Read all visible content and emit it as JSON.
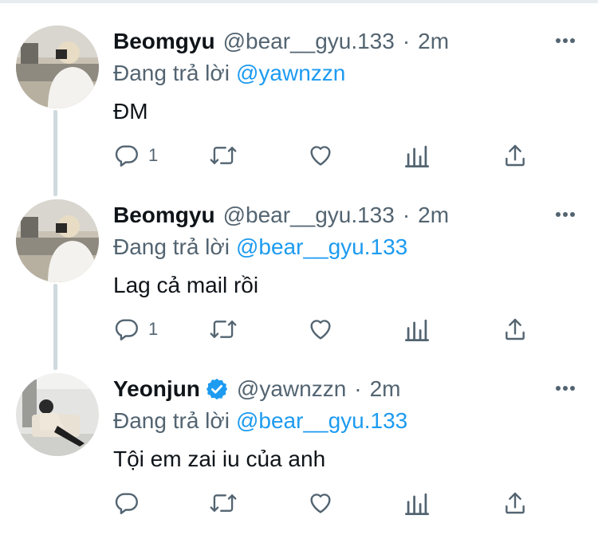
{
  "tweets": [
    {
      "name": "Beomgyu",
      "handle": "@bear__gyu.133",
      "separator": "·",
      "time": "2m",
      "reply_prefix": "Đang trả lời",
      "reply_to": "@yawnzzn",
      "text": "ĐM",
      "reply_count": "1",
      "avatar": "beomgyu-avatar",
      "verified": false
    },
    {
      "name": "Beomgyu",
      "handle": "@bear__gyu.133",
      "separator": "·",
      "time": "2m",
      "reply_prefix": "Đang trả lời",
      "reply_to": "@bear__gyu.133",
      "text": "Lag cả mail rồi",
      "reply_count": "1",
      "avatar": "beomgyu-avatar",
      "verified": false
    },
    {
      "name": "Yeonjun",
      "handle": "@yawnzzn",
      "separator": "·",
      "time": "2m",
      "reply_prefix": "Đang trả lời",
      "reply_to": "@bear__gyu.133",
      "text": "Tội em zai iu của anh",
      "reply_count": "",
      "avatar": "yeonjun-avatar",
      "verified": true
    }
  ],
  "icons": [
    "more-icon",
    "reply-icon",
    "retweet-icon",
    "like-icon",
    "analytics-icon",
    "share-icon",
    "verified-badge-icon"
  ],
  "colors": {
    "link": "#1d9bf0",
    "secondary": "#536471",
    "icon": "#536471",
    "verified": "#1d9bf0",
    "thread_line": "#cfd9de"
  }
}
